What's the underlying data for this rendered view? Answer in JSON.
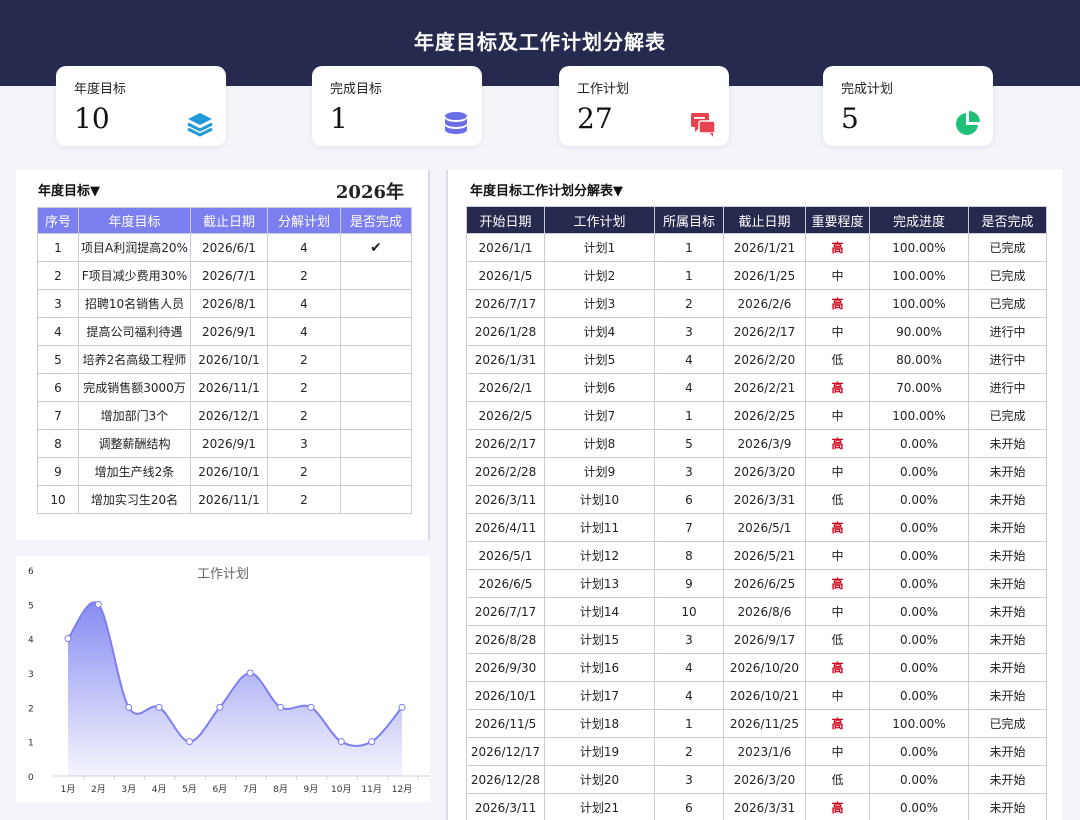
{
  "header": {
    "title": "年度目标及工作计划分解表"
  },
  "kpis": [
    {
      "label": "年度目标",
      "value": "10",
      "icon": "layers-icon",
      "color": "#1e9bd7"
    },
    {
      "label": "完成目标",
      "value": "1",
      "icon": "database-icon",
      "color": "#6a6ee8"
    },
    {
      "label": "工作计划",
      "value": "27",
      "icon": "chat-icon",
      "color": "#e8434f"
    },
    {
      "label": "完成计划",
      "value": "5",
      "icon": "pie-chart-icon",
      "color": "#20c07a"
    }
  ],
  "goals": {
    "title": "年度目标▼",
    "year": "2026年",
    "columns": [
      "序号",
      "年度目标",
      "截止日期",
      "分解计划",
      "是否完成"
    ],
    "rows": [
      [
        "1",
        "项目A利润提高20%",
        "2026/6/1",
        "4",
        "✔"
      ],
      [
        "2",
        "F项目减少费用30%",
        "2026/7/1",
        "2",
        ""
      ],
      [
        "3",
        "招聘10名销售人员",
        "2026/8/1",
        "4",
        ""
      ],
      [
        "4",
        "提高公司福利待遇",
        "2026/9/1",
        "4",
        ""
      ],
      [
        "5",
        "培养2名高级工程师",
        "2026/10/1",
        "2",
        ""
      ],
      [
        "6",
        "完成销售额3000万",
        "2026/11/1",
        "2",
        ""
      ],
      [
        "7",
        "增加部门3个",
        "2026/12/1",
        "2",
        ""
      ],
      [
        "8",
        "调整薪酬结构",
        "2026/9/1",
        "3",
        ""
      ],
      [
        "9",
        "增加生产线2条",
        "2026/10/1",
        "2",
        ""
      ],
      [
        "10",
        "增加实习生20名",
        "2026/11/1",
        "2",
        ""
      ]
    ]
  },
  "plans": {
    "title": "年度目标工作计划分解表▼",
    "columns": [
      "开始日期",
      "工作计划",
      "所属目标",
      "截止日期",
      "重要程度",
      "完成进度",
      "是否完成"
    ],
    "rows": [
      [
        "2026/1/1",
        "计划1",
        "1",
        "2026/1/21",
        "高",
        "100.00%",
        "已完成"
      ],
      [
        "2026/1/5",
        "计划2",
        "1",
        "2026/1/25",
        "中",
        "100.00%",
        "已完成"
      ],
      [
        "2026/7/17",
        "计划3",
        "2",
        "2026/2/6",
        "高",
        "100.00%",
        "已完成"
      ],
      [
        "2026/1/28",
        "计划4",
        "3",
        "2026/2/17",
        "中",
        "90.00%",
        "进行中"
      ],
      [
        "2026/1/31",
        "计划5",
        "4",
        "2026/2/20",
        "低",
        "80.00%",
        "进行中"
      ],
      [
        "2026/2/1",
        "计划6",
        "4",
        "2026/2/21",
        "高",
        "70.00%",
        "进行中"
      ],
      [
        "2026/2/5",
        "计划7",
        "1",
        "2026/2/25",
        "中",
        "100.00%",
        "已完成"
      ],
      [
        "2026/2/17",
        "计划8",
        "5",
        "2026/3/9",
        "高",
        "0.00%",
        "未开始"
      ],
      [
        "2026/2/28",
        "计划9",
        "3",
        "2026/3/20",
        "中",
        "0.00%",
        "未开始"
      ],
      [
        "2026/3/11",
        "计划10",
        "6",
        "2026/3/31",
        "低",
        "0.00%",
        "未开始"
      ],
      [
        "2026/4/11",
        "计划11",
        "7",
        "2026/5/1",
        "高",
        "0.00%",
        "未开始"
      ],
      [
        "2026/5/1",
        "计划12",
        "8",
        "2026/5/21",
        "中",
        "0.00%",
        "未开始"
      ],
      [
        "2026/6/5",
        "计划13",
        "9",
        "2026/6/25",
        "高",
        "0.00%",
        "未开始"
      ],
      [
        "2026/7/17",
        "计划14",
        "10",
        "2026/8/6",
        "中",
        "0.00%",
        "未开始"
      ],
      [
        "2026/8/28",
        "计划15",
        "3",
        "2026/9/17",
        "低",
        "0.00%",
        "未开始"
      ],
      [
        "2026/9/30",
        "计划16",
        "4",
        "2026/10/20",
        "高",
        "0.00%",
        "未开始"
      ],
      [
        "2026/10/1",
        "计划17",
        "4",
        "2026/10/21",
        "中",
        "0.00%",
        "未开始"
      ],
      [
        "2026/11/5",
        "计划18",
        "1",
        "2026/11/25",
        "高",
        "100.00%",
        "已完成"
      ],
      [
        "2026/12/17",
        "计划19",
        "2",
        "2023/1/6",
        "中",
        "0.00%",
        "未开始"
      ],
      [
        "2026/12/28",
        "计划20",
        "3",
        "2026/3/20",
        "低",
        "0.00%",
        "未开始"
      ],
      [
        "2026/3/11",
        "计划21",
        "6",
        "2026/3/31",
        "高",
        "0.00%",
        "未开始"
      ]
    ],
    "high_color": "#d0021b"
  },
  "chart_data": {
    "type": "area",
    "title": "工作计划",
    "categories": [
      "1月",
      "2月",
      "3月",
      "4月",
      "5月",
      "6月",
      "7月",
      "8月",
      "9月",
      "10月",
      "11月",
      "12月"
    ],
    "values": [
      4,
      5,
      2,
      2,
      1,
      2,
      3,
      2,
      2,
      1,
      1,
      2
    ],
    "ylim": [
      0,
      6
    ],
    "yticks": [
      "0",
      "1",
      "2",
      "3",
      "4",
      "5",
      "6"
    ],
    "color": "#7b7ff0",
    "xlabel": "",
    "ylabel": ""
  }
}
